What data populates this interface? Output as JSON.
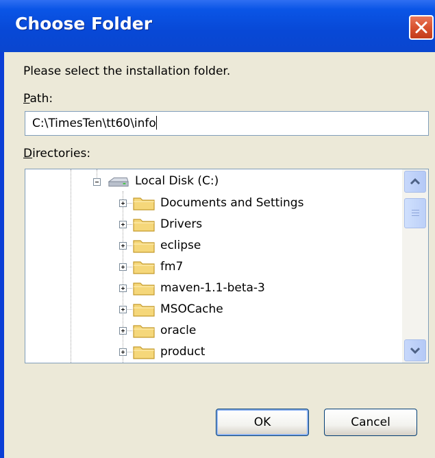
{
  "window": {
    "title": "Choose Folder"
  },
  "dialog": {
    "prompt": "Please select the installation folder.",
    "path_label": "Path:",
    "path_value": "C:\\TimesTen\\tt60\\info",
    "directories_label": "Directories:"
  },
  "tree": {
    "root": {
      "label": "Local Disk (C:)",
      "icon": "hard-drive-icon",
      "expanded": true
    },
    "children": [
      {
        "label": "Documents and Settings",
        "icon": "folder-icon"
      },
      {
        "label": "Drivers",
        "icon": "folder-icon"
      },
      {
        "label": "eclipse",
        "icon": "folder-icon"
      },
      {
        "label": "fm7",
        "icon": "folder-icon"
      },
      {
        "label": "maven-1.1-beta-3",
        "icon": "folder-icon"
      },
      {
        "label": "MSOCache",
        "icon": "folder-icon"
      },
      {
        "label": "oracle",
        "icon": "folder-icon"
      },
      {
        "label": "product",
        "icon": "folder-icon"
      }
    ]
  },
  "buttons": {
    "ok": "OK",
    "cancel": "Cancel"
  },
  "colors": {
    "titlebar": "#0a55e6",
    "dialog_bg": "#ece9d8",
    "folder": "#f5d77a"
  }
}
